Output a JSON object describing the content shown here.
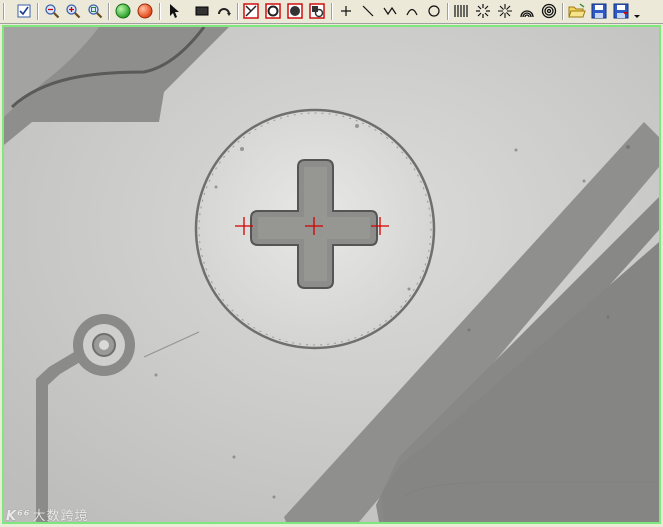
{
  "toolbar": {
    "tools": [
      {
        "name": "checklist-icon"
      },
      {
        "name": "zoom-out-icon"
      },
      {
        "name": "zoom-in-icon"
      },
      {
        "name": "zoom-fit-icon"
      },
      {
        "name": "green-status-icon",
        "color": "#2db32d"
      },
      {
        "name": "red-status-icon",
        "color": "#e8531f"
      },
      {
        "name": "pointer-icon"
      },
      {
        "name": "rectangle-icon"
      },
      {
        "name": "rotate-icon"
      },
      {
        "name": "roi-rect-icon"
      },
      {
        "name": "roi-circle-icon"
      },
      {
        "name": "roi-fill-icon"
      },
      {
        "name": "roi-mask-icon"
      },
      {
        "name": "cross-point-icon"
      },
      {
        "name": "line-icon"
      },
      {
        "name": "polyline-icon"
      },
      {
        "name": "arc-icon"
      },
      {
        "name": "circle-icon"
      },
      {
        "name": "edge-lines-icon"
      },
      {
        "name": "radial-lines-icon"
      },
      {
        "name": "radial-star-icon"
      },
      {
        "name": "arc-rings-icon"
      },
      {
        "name": "concentric-rings-icon"
      },
      {
        "name": "open-folder-icon"
      },
      {
        "name": "save-icon"
      },
      {
        "name": "save-as-icon"
      }
    ]
  },
  "image": {
    "frame_color": "#7ee87e",
    "marker_color": "#d40000",
    "markers": [
      "left-marker",
      "center-marker",
      "right-marker"
    ]
  },
  "watermark": {
    "logo": "K⁶⁶",
    "text": "大数跨境"
  }
}
